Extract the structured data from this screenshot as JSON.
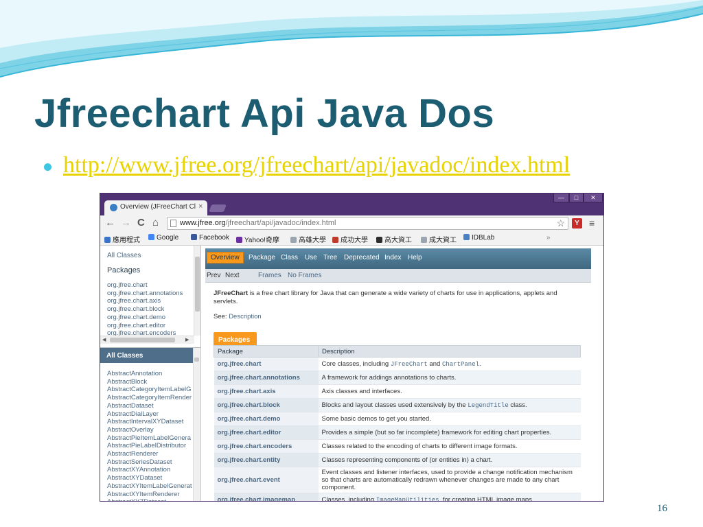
{
  "slide": {
    "title": "Jfreechart Api Java Dos",
    "link": "http://www.jfree.org/jfreechart/api/javadoc/index.html",
    "page_number": "16",
    "colors": {
      "title": "#1c5d72",
      "link": "#e8d200",
      "bullet": "#3fc6e3"
    }
  },
  "browser": {
    "tab_title": "Overview (JFreeChart Cla",
    "tab_close": "×",
    "window_controls": {
      "minimize": "—",
      "maximize": "□",
      "close": "✕"
    },
    "nav_icons": {
      "back": "←",
      "forward": "→",
      "reload": "C",
      "home": "⌂"
    },
    "url_host": "www.jfree.org",
    "url_path": "/jfreechart/api/javadoc/index.html",
    "star": "☆",
    "menu": "≡",
    "extension_badge": "Y",
    "bookmarks": [
      {
        "label": "應用程式",
        "color": "#3a74c9"
      },
      {
        "label": "Google",
        "color": "#4285f4"
      },
      {
        "label": "Facebook",
        "color": "#3b5998"
      },
      {
        "label": "Yahoo!奇摩",
        "color": "#6b2fa0"
      },
      {
        "label": "高雄大學",
        "color": "#9aa5b0"
      },
      {
        "label": "成功大學",
        "color": "#c0392b"
      },
      {
        "label": "高大資工",
        "color": "#2d2d2d"
      },
      {
        "label": "成大資工",
        "color": "#9aa5b0"
      },
      {
        "label": "IDBLab",
        "color": "#4a80c4"
      }
    ],
    "bookmarks_more": "»"
  },
  "javadoc": {
    "left_top": {
      "all_classes": "All Classes",
      "packages_heading": "Packages",
      "packages": [
        "org.jfree.chart",
        "org.jfree.chart.annotations",
        "org.jfree.chart.axis",
        "org.jfree.chart.block",
        "org.jfree.chart.demo",
        "org.jfree.chart.editor",
        "org.jfree.chart.encoders"
      ]
    },
    "left_bottom": {
      "heading": "All Classes",
      "classes": [
        "AbstractAnnotation",
        "AbstractBlock",
        "AbstractCategoryItemLabelG",
        "AbstractCategoryItemRender",
        "AbstractDataset",
        "AbstractDialLayer",
        "AbstractIntervalXYDataset",
        "AbstractOverlay",
        "AbstractPieItemLabelGenera",
        "AbstractPieLabelDistributor",
        "AbstractRenderer",
        "AbstractSeriesDataset",
        "AbstractXYAnnotation",
        "AbstractXYDataset",
        "AbstractXYItemLabelGenerat",
        "AbstractXYItemRenderer",
        "AbstractXYZDataset"
      ]
    },
    "navbar": {
      "overview": "Overview",
      "items": [
        "Package",
        "Class",
        "Use",
        "Tree",
        "Deprecated",
        "Index",
        "Help"
      ]
    },
    "subnav": {
      "prev": "Prev",
      "next": "Next",
      "frames": "Frames",
      "no_frames": "No Frames"
    },
    "description": {
      "bold": "JFreeChart",
      "rest": " is a free chart library for Java that can generate a wide variety of charts for use in applications, applets and servlets."
    },
    "see": {
      "label": "See: ",
      "link": "Description"
    },
    "packages_tab": "Packages",
    "table": {
      "headers": [
        "Package",
        "Description"
      ],
      "rows": [
        {
          "name": "org.jfree.chart",
          "parts": [
            "Core classes, including ",
            {
              "code": "JFreeChart"
            },
            " and ",
            {
              "code": "ChartPanel"
            },
            "."
          ]
        },
        {
          "name": "org.jfree.chart.annotations",
          "parts": [
            "A framework for addings annotations to charts."
          ]
        },
        {
          "name": "org.jfree.chart.axis",
          "parts": [
            "Axis classes and interfaces."
          ]
        },
        {
          "name": "org.jfree.chart.block",
          "parts": [
            "Blocks and layout classes used extensively by the ",
            {
              "code": "LegendTitle"
            },
            " class."
          ]
        },
        {
          "name": "org.jfree.chart.demo",
          "parts": [
            "Some basic demos to get you started."
          ]
        },
        {
          "name": "org.jfree.chart.editor",
          "parts": [
            "Provides a simple (but so far incomplete) framework for editing chart properties."
          ]
        },
        {
          "name": "org.jfree.chart.encoders",
          "parts": [
            "Classes related to the encoding of charts to different image formats."
          ]
        },
        {
          "name": "org.jfree.chart.entity",
          "parts": [
            "Classes representing components of (or entities in) a chart."
          ]
        },
        {
          "name": "org.jfree.chart.event",
          "parts": [
            "Event classes and listener interfaces, used to provide a change notification mechanism so that charts are automatically redrawn whenever changes are made to any chart component."
          ]
        },
        {
          "name": "org.jfree.chart.imagemap",
          "parts": [
            "Classes, including ",
            {
              "code": "ImageMapUtilities"
            },
            ", for creating HTML image maps."
          ]
        }
      ]
    }
  }
}
